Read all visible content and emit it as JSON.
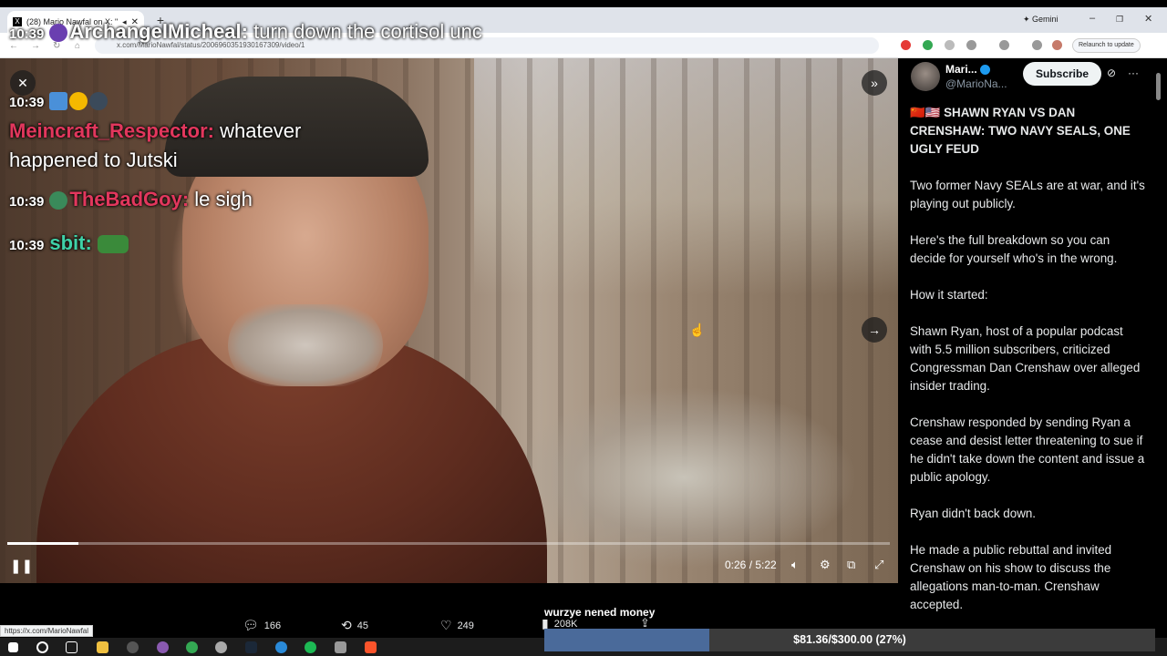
{
  "browser": {
    "tab_title": "(28) Mario Nawfal on X: \"SI...",
    "url": "x.com/MarioNawfal/status/2006960351930167309/video/1",
    "gemini_label": "Gemini",
    "relaunch_label": "Relaunch to update",
    "status_url": "https://x.com/MarioNawfal"
  },
  "chat": [
    {
      "time": "10:39",
      "user": "ArchangelMicheal",
      "user_color": "#ffffff",
      "message": "turn down the cortisol unc"
    },
    {
      "time": "10:39",
      "user": "",
      "user_color": "#ffffff",
      "message": ""
    },
    {
      "time": "",
      "user": "Meincraft_Respector",
      "user_color": "#e2375d",
      "message": "whatever happened to Jutski"
    },
    {
      "time": "10:39",
      "user": "TheBadGoy",
      "user_color": "#e2375d",
      "message": "le sigh"
    },
    {
      "time": "10:39",
      "user": "sbit",
      "user_color": "#3fd2a8",
      "message": ""
    }
  ],
  "video": {
    "current_time": "0:26",
    "duration": "5:22",
    "time_display": "0:26 / 5:22",
    "progress": 0.081
  },
  "actions": {
    "replies": "166",
    "reposts": "45",
    "likes": "249",
    "views": "208K"
  },
  "tweet": {
    "author_name": "Mari...",
    "author_handle": "@MarioNa...",
    "subscribe_label": "Subscribe",
    "flags": "🇨🇳🇺🇸",
    "title": "SHAWN RYAN VS DAN CRENSHAW: TWO NAVY SEALS, ONE UGLY FEUD",
    "paragraphs": [
      "Two former Navy SEALs are at war, and it's playing out publicly.",
      "Here's the full breakdown so you can decide for yourself who's in the wrong.",
      "How it started:",
      "Shawn Ryan, host of a popular podcast with 5.5 million subscribers, criticized Congressman Dan Crenshaw over alleged insider trading.",
      "Crenshaw responded by sending Ryan a cease and desist letter threatening to sue if he didn't take down the content and issue a public apology.",
      "Ryan didn't back down.",
      "He made a public rebuttal and invited Crenshaw on his show to discuss the allegations man-to-man. Crenshaw accepted."
    ]
  },
  "goal": {
    "label": "wurzye nened money",
    "text": "$81.36/$300.00 (27%)",
    "progress": 0.27
  },
  "colors": {
    "accent": "#1d9bf0",
    "goal_fill": "#4a6a9a"
  }
}
